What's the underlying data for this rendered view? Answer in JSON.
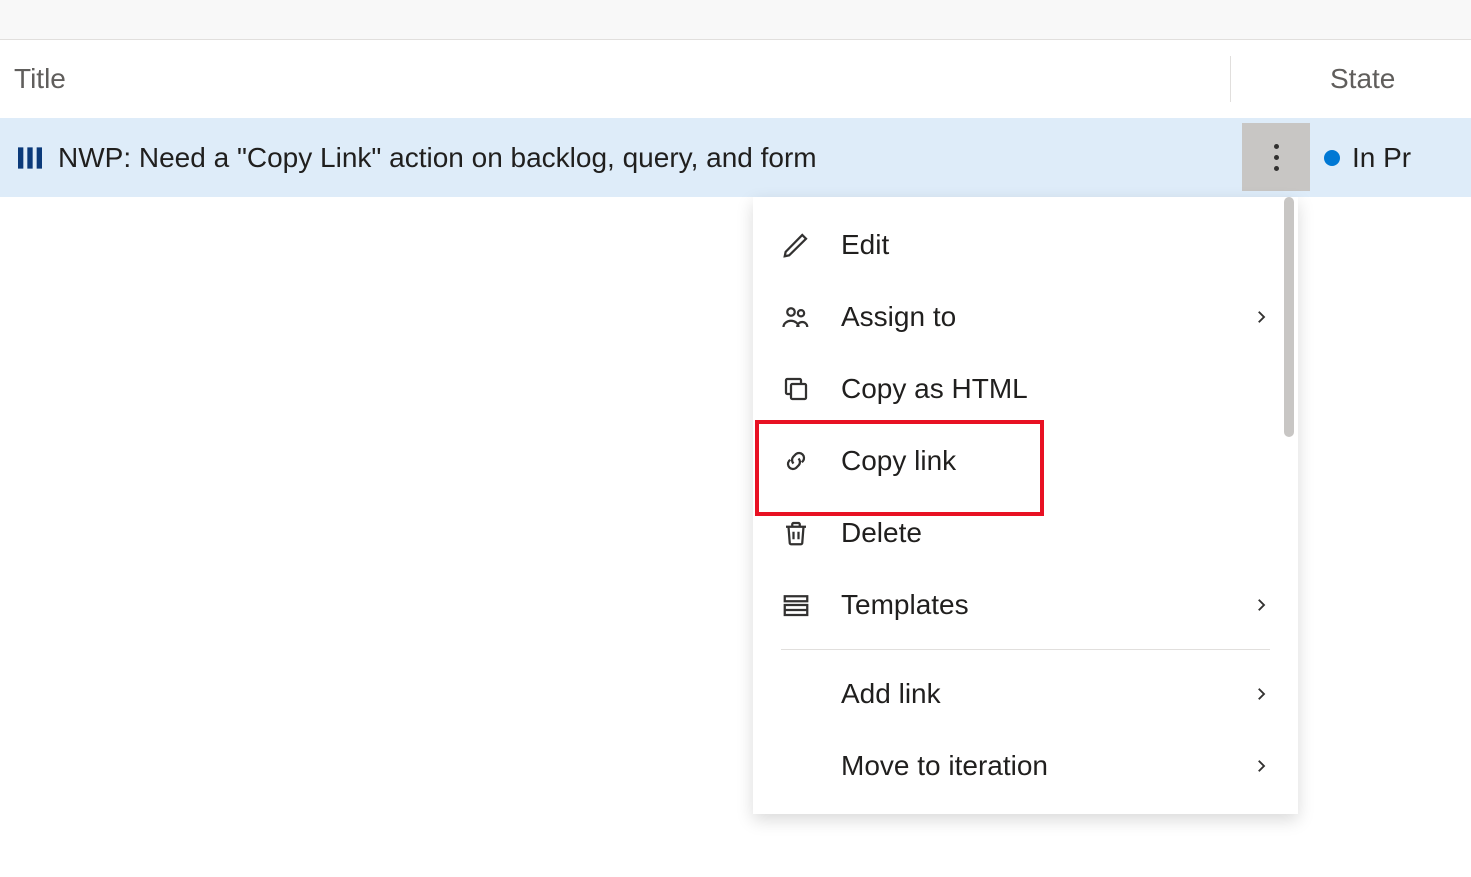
{
  "columns": {
    "title": "Title",
    "state": "State"
  },
  "item": {
    "title": "NWP: Need a \"Copy Link\" action on backlog, query, and form",
    "state": "In Pr",
    "state_color": "#0078d4"
  },
  "menu": {
    "edit": "Edit",
    "assign_to": "Assign to",
    "copy_html": "Copy as HTML",
    "copy_link": "Copy link",
    "delete": "Delete",
    "templates": "Templates",
    "add_link": "Add link",
    "move_iteration": "Move to iteration"
  }
}
